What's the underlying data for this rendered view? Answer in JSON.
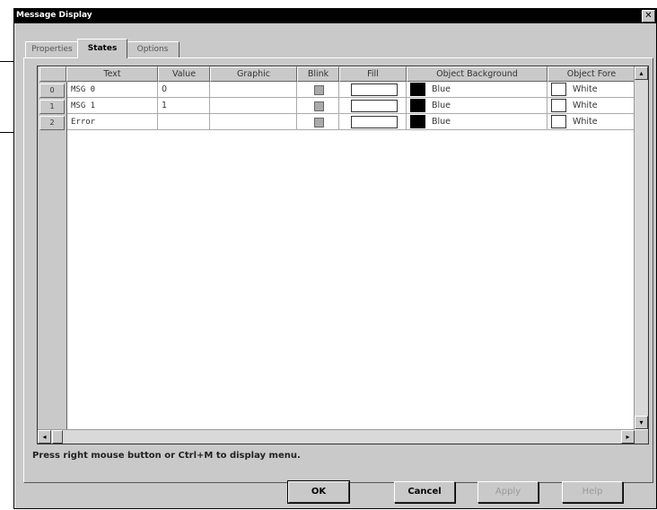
{
  "window": {
    "title": "Message Display",
    "close_glyph": "✕"
  },
  "tabs": [
    {
      "label": "Properties"
    },
    {
      "label": "States"
    },
    {
      "label": "Options"
    }
  ],
  "grid": {
    "columns": [
      "Text",
      "Value",
      "Graphic",
      "Blink",
      "Fill",
      "Object Background",
      "Object Fore"
    ],
    "rows": [
      {
        "num": "0",
        "text": "MSG 0",
        "value": "0",
        "graphic": "",
        "bg": "Blue",
        "fg": "White"
      },
      {
        "num": "1",
        "text": "MSG 1",
        "value": "1",
        "graphic": "",
        "bg": "Blue",
        "fg": "White"
      },
      {
        "num": "2",
        "text": "Error",
        "value": "",
        "graphic": "",
        "bg": "Blue",
        "fg": "White"
      }
    ]
  },
  "hint": "Press right mouse button or Ctrl+M to display menu.",
  "buttons": {
    "ok": "OK",
    "cancel": "Cancel",
    "apply": "Apply",
    "help": "Help"
  },
  "icons": {
    "scroll_up": "scroll-up-arrow",
    "scroll_down": "scroll-down-arrow",
    "scroll_left": "scroll-left-arrow",
    "scroll_right": "scroll-right-arrow"
  },
  "colors": {
    "swatch_dark": "#000000",
    "swatch_light": "#ffffff",
    "dialog_face": "#c9c9c9"
  }
}
